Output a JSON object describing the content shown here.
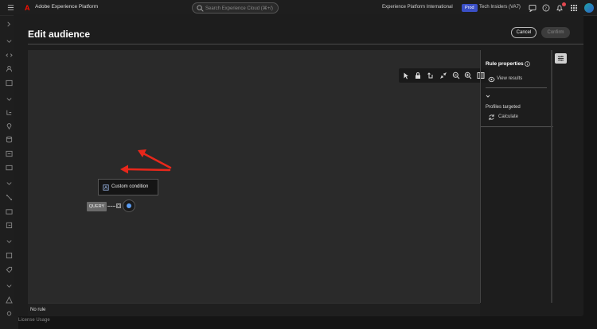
{
  "topbar": {
    "app_name": "Adobe Experience Platform",
    "search_placeholder": "Search Experience Cloud (⌘+/)",
    "sandbox_name": "Experience Platform International",
    "prod_badge": "Prod",
    "org_name": "Tech Insiders (VA7)",
    "notification_count": ""
  },
  "background": {
    "footer_text": "License Usage"
  },
  "dialog": {
    "title": "Edit audience",
    "cancel_label": "Cancel",
    "confirm_label": "Confirm"
  },
  "canvas": {
    "query_node_label": "QUERY",
    "condition_label": "Custom condition",
    "rule_status": "No rule"
  },
  "properties": {
    "title": "Rule properties",
    "view_results_label": "View results",
    "profiles_targeted_label": "Profiles targeted",
    "calculate_label": "Calculate"
  },
  "colors": {
    "accent_blue": "#5b9cf2",
    "arrow_red": "#e8271b",
    "prod_badge": "#3a4fc6",
    "adobe_red": "#fa0f00"
  },
  "icons": [
    "menu-icon",
    "adobe-logo-icon",
    "search-icon",
    "help-icon",
    "bell-icon",
    "apps-grid-icon",
    "pointer-icon",
    "lock-icon",
    "undo-icon",
    "collapse-icon",
    "zoom-out-icon",
    "zoom-in-icon",
    "panel-icon",
    "info-icon",
    "eye-icon",
    "refresh-icon",
    "settings-icon",
    "close-icon",
    "add-icon"
  ]
}
